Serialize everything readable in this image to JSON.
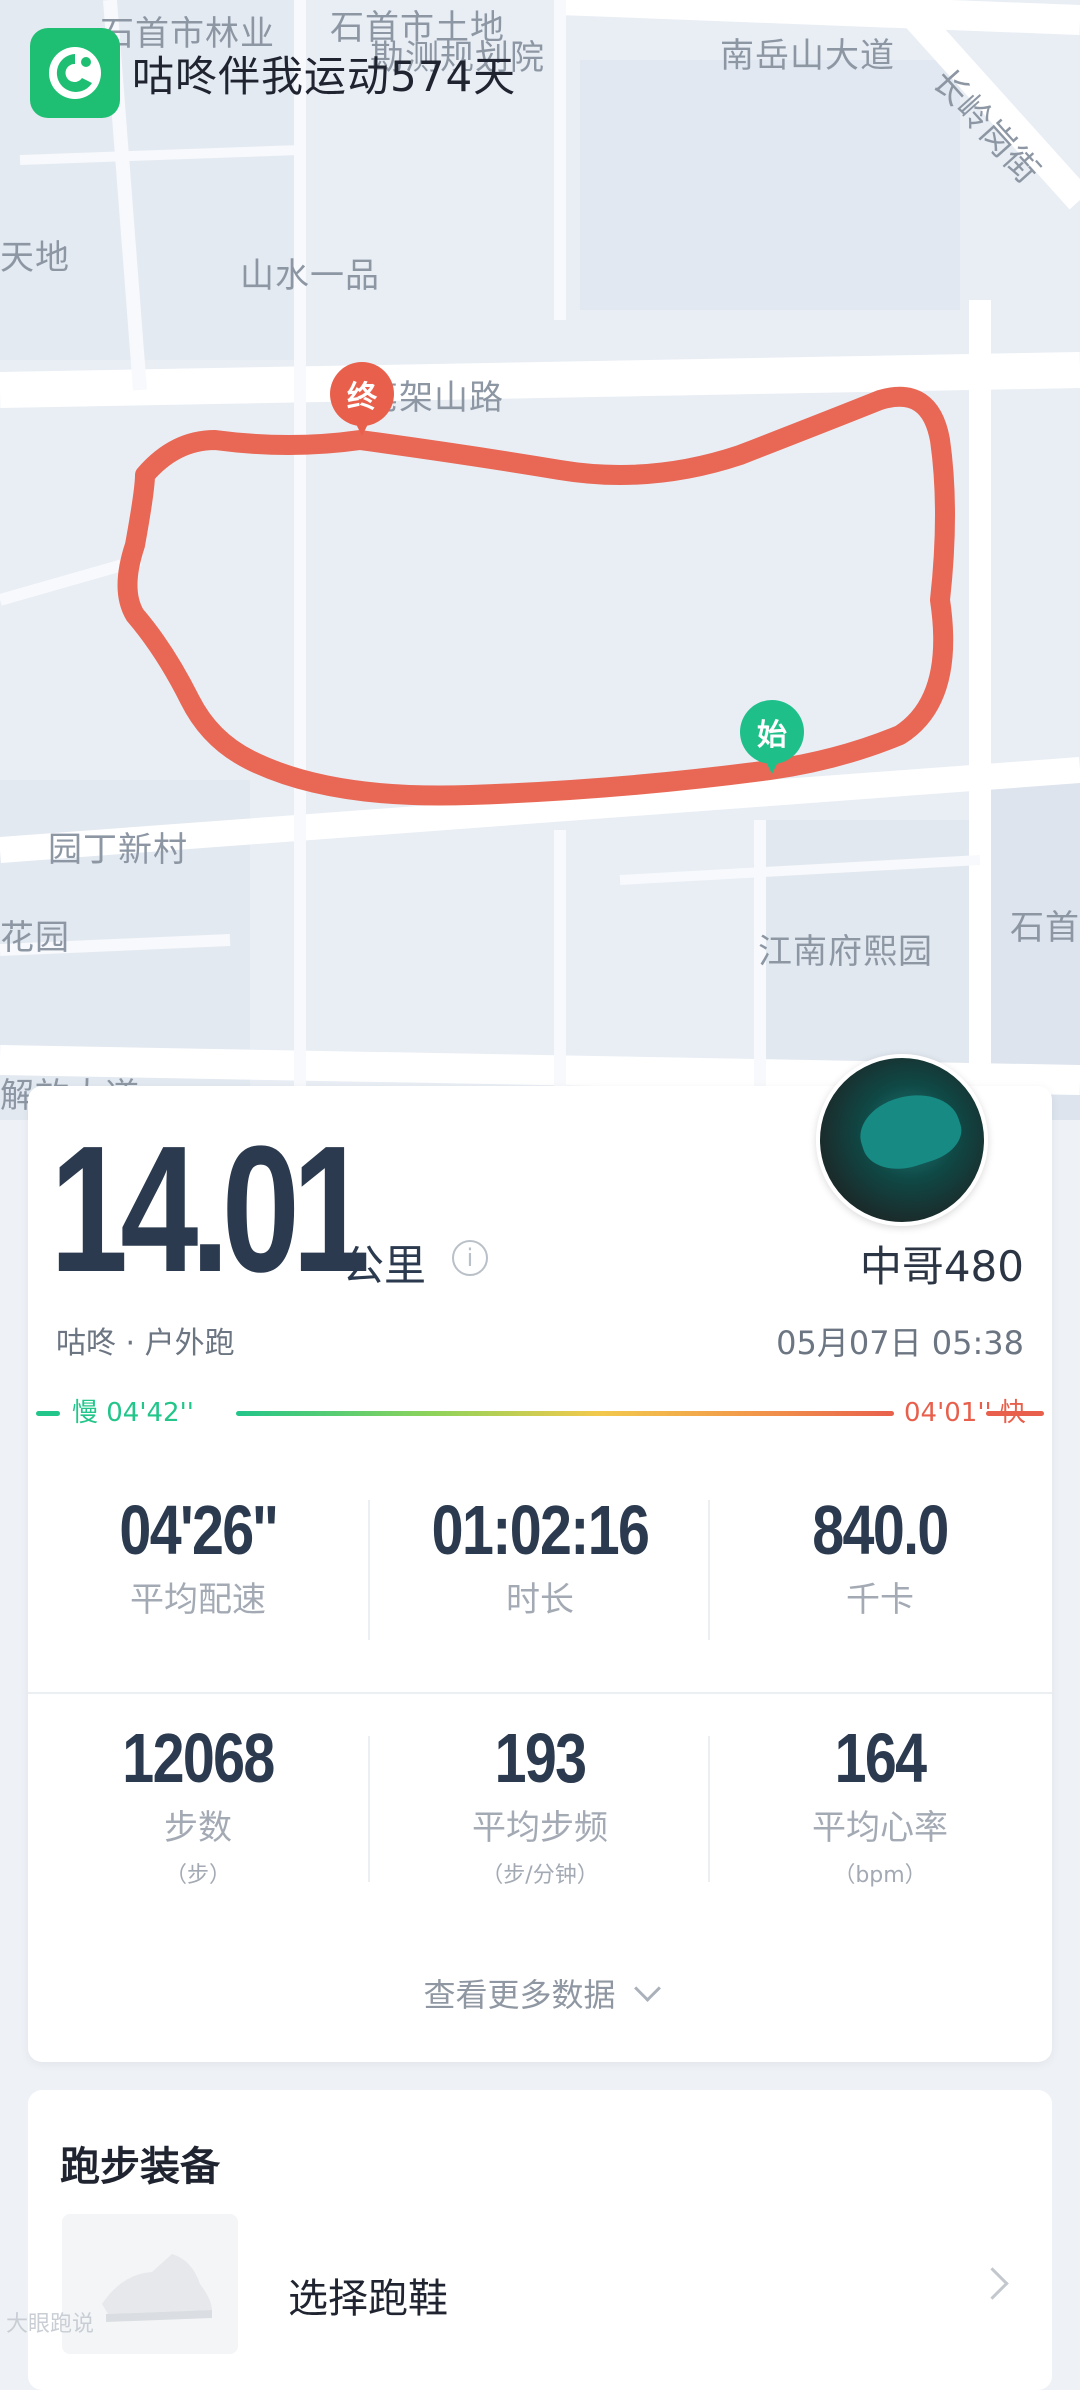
{
  "app": {
    "title": "咕咚伴我运动574天",
    "logo_icon": "codoon-logo-icon"
  },
  "map": {
    "labels": {
      "l1": "石首市林业",
      "l2": "石首市土地",
      "l3": "勘测规划院",
      "l4": "南岳山大道",
      "l5": "长岭岗街",
      "l6": "天地",
      "l7": "山水一品",
      "l8": "笔架山路",
      "l9": "园丁新村",
      "l10": "花园",
      "l11": "江南府熙园",
      "l12": "石首",
      "l13": "解放大道"
    },
    "end_marker": "终",
    "start_marker": "始",
    "route_color": "#e8604c"
  },
  "summary": {
    "distance": "14.01",
    "unit": "公里",
    "username": "中哥480",
    "activity": "咕咚 · 户外跑",
    "datetime": "05月07日 05:38",
    "pace_slow": "慢 04'42''",
    "pace_fast": "04'01'' 快"
  },
  "stats": {
    "avg_pace": {
      "value": "04'26''",
      "label": "平均配速"
    },
    "duration": {
      "value": "01:02:16",
      "label": "时长"
    },
    "calories": {
      "value": "840.0",
      "label": "千卡"
    },
    "steps": {
      "value": "12068",
      "label": "步数",
      "sub": "（步）"
    },
    "cadence": {
      "value": "193",
      "label": "平均步频",
      "sub": "（步/分钟）"
    },
    "heart_rate": {
      "value": "164",
      "label": "平均心率",
      "sub": "（bpm）"
    }
  },
  "more_label": "查看更多数据",
  "gear": {
    "title": "跑步装备",
    "item": "选择跑鞋"
  },
  "watermark": "大眼跑说",
  "colors": {
    "slow": "#22c58a",
    "fast": "#e8604c",
    "brand": "#1fbf73"
  }
}
